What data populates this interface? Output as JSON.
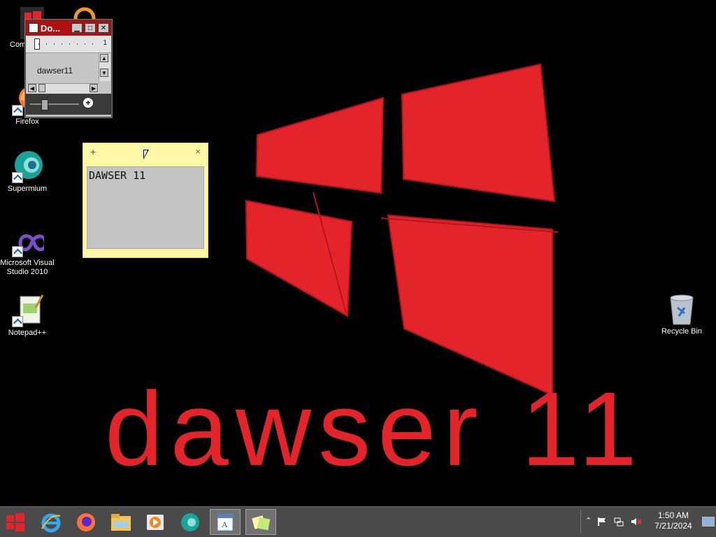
{
  "wallpaper": {
    "text": "dawser 11",
    "color": "#e3242b"
  },
  "desktop_icons": [
    {
      "id": "computer",
      "label": "Com"
    },
    {
      "id": "firefox",
      "label": "Firefox"
    },
    {
      "id": "supermium",
      "label": "Supermium"
    },
    {
      "id": "vs2010",
      "label": "Microsoft Visual Studio 2010"
    },
    {
      "id": "notepadpp",
      "label": "Notepad++"
    },
    {
      "id": "recycle",
      "label": "Recycle Bin"
    }
  ],
  "mini_window": {
    "title": "Do...",
    "ruler_value": "1",
    "body_text": "dawser11"
  },
  "sticky_note": {
    "add_symbol": "+",
    "close_symbol": "×",
    "text": "DAWSER 11"
  },
  "taskbar": {
    "apps": [
      "start-menu",
      "internet-explorer",
      "firefox",
      "file-explorer",
      "media-player",
      "supermium",
      "wordpad",
      "sticky-notes"
    ],
    "active_apps": [
      "wordpad",
      "sticky-notes"
    ]
  },
  "tray": {
    "time": "1:50 AM",
    "date": "7/21/2024",
    "icons": [
      "chevron-up-icon",
      "action-center-flag-icon",
      "network-icon",
      "volume-muted-icon"
    ]
  },
  "colors": {
    "accent_red": "#e3242b",
    "taskbar": "#4a4a4a",
    "sticky": "#fdf7a6"
  }
}
